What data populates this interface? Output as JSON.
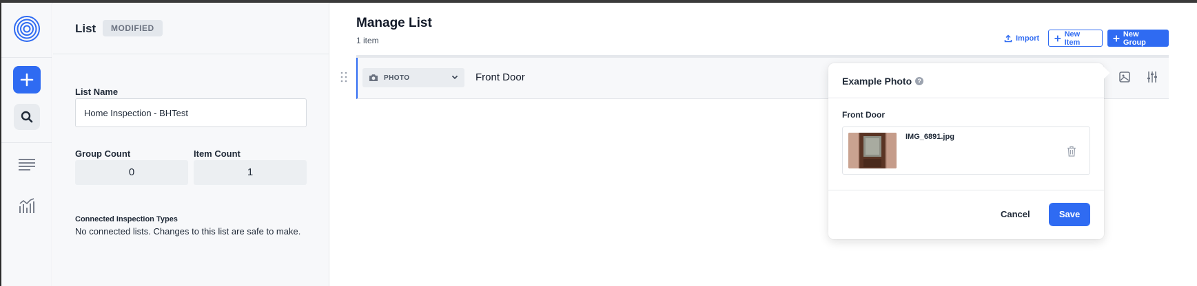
{
  "colors": {
    "accent": "#2f6bf2",
    "rail_bg": "#f7f8fa",
    "badge_bg": "#e3e7ec"
  },
  "rail": {
    "icons": [
      "logo-icon",
      "plus-icon",
      "search-icon",
      "list-icon",
      "chart-icon"
    ]
  },
  "panel": {
    "title": "List",
    "badge": "MODIFIED",
    "list_name_label": "List Name",
    "list_name_value": "Home Inspection - BHTest",
    "group_count_label": "Group Count",
    "group_count_value": "0",
    "item_count_label": "Item Count",
    "item_count_value": "1",
    "connected_title": "Connected Inspection Types",
    "connected_text": "No connected lists. Changes to this list are safe to make."
  },
  "main": {
    "title": "Manage List",
    "subtitle": "1 item",
    "toolbar": {
      "import_label": "Import",
      "new_item_label": "New Item",
      "new_group_label": "New Group"
    },
    "row": {
      "type_label": "PHOTO",
      "item_title": "Front Door"
    }
  },
  "popover": {
    "title": "Example Photo",
    "help_glyph": "?",
    "item_label": "Front Door",
    "file_name": "IMG_6891.jpg",
    "cancel_label": "Cancel",
    "save_label": "Save"
  }
}
